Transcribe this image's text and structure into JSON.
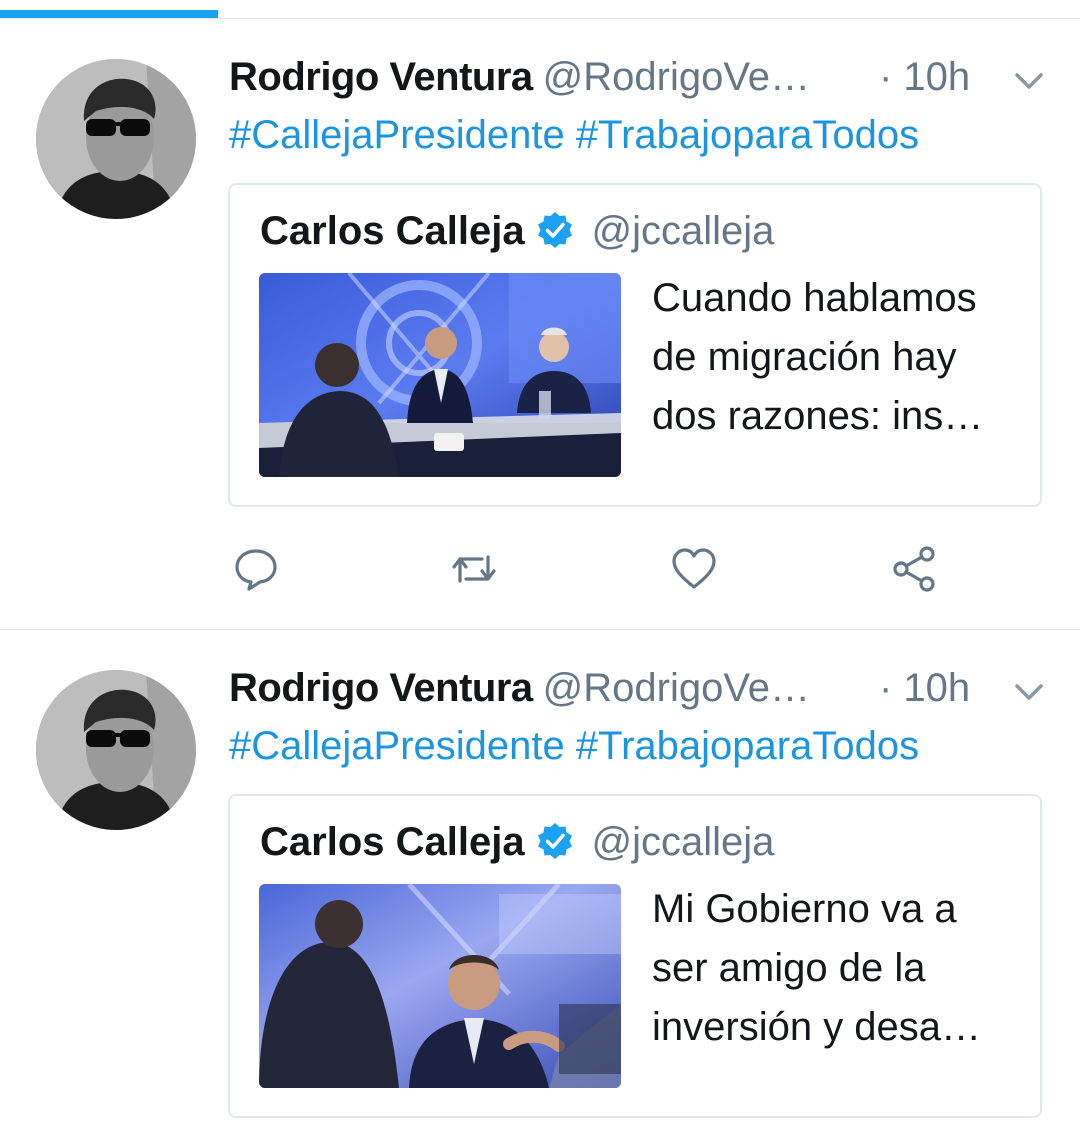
{
  "tweets": [
    {
      "author_name": "Rodrigo Ventura",
      "author_handle": "@RodrigoVe…",
      "time": "· 10h",
      "hashtags": [
        "#CallejaPresidente",
        "#TrabajoparaTodos"
      ],
      "quote": {
        "name": "Carlos Calleja",
        "handle": "@jccalleja",
        "lines": [
          "Cuando hablamos",
          "de migración hay",
          "dos razones: ins…"
        ]
      }
    },
    {
      "author_name": "Rodrigo Ventura",
      "author_handle": "@RodrigoVe…",
      "time": "· 10h",
      "hashtags": [
        "#CallejaPresidente",
        "#TrabajoparaTodos"
      ],
      "quote": {
        "name": "Carlos Calleja",
        "handle": "@jccalleja",
        "lines": [
          "Mi Gobierno va a",
          "ser amigo de la",
          "inversión y desa…"
        ]
      }
    }
  ],
  "icons": {
    "caret": "chevron-down-icon",
    "verified": "verified-badge-icon",
    "reply": "reply-icon",
    "retweet": "retweet-icon",
    "like": "heart-icon",
    "share": "share-icon"
  },
  "colors": {
    "accent": "#1da1f2",
    "link": "#1b95e0",
    "text": "#14171a",
    "secondary": "#657786",
    "border": "#e1e8ed"
  }
}
